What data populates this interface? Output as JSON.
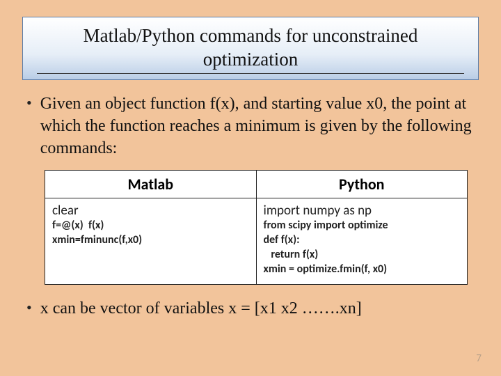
{
  "title": "Matlab/Python commands for unconstrained optimization",
  "bullets": {
    "b1": "Given an object function f(x), and starting value x0, the point at which the function reaches a minimum is given by the following commands:",
    "b2": "x can be vector of variables x = [x1 x2 …….xn]"
  },
  "table": {
    "headers": {
      "left": "Matlab",
      "right": "Python"
    },
    "matlab": {
      "l1": "clear",
      "l2": "f=@(x)  f(x)",
      "l3": "xmin=fminunc(f,x0)"
    },
    "python": {
      "l1": "import numpy as np",
      "l2": "from scipy import optimize",
      "l3": "def f(x):",
      "l4": "   return f(x)",
      "l5": "xmin = optimize.fmin(f, x0)"
    }
  },
  "page_number": "7"
}
